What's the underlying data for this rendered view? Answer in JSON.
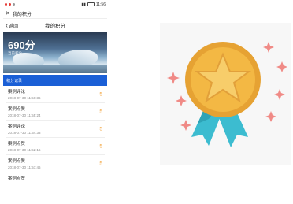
{
  "status_bar": {
    "time": "11:56"
  },
  "window": {
    "title": "我的积分",
    "more": "···"
  },
  "nav": {
    "back_label": "返回",
    "title": "我的积分"
  },
  "banner": {
    "points": "690分",
    "note": "当前积分"
  },
  "section": {
    "title": "积分记录"
  },
  "records": [
    {
      "title": "案例评论",
      "time": "2018-07-30 11:56:36",
      "score": "5"
    },
    {
      "title": "案例点赞",
      "time": "2018-07-30 11:55:24",
      "score": "5"
    },
    {
      "title": "案例评论",
      "time": "2018-07-30 11:54:33",
      "score": "5"
    },
    {
      "title": "案例点赞",
      "time": "2018-07-30 11:52:16",
      "score": "5"
    },
    {
      "title": "案例点赞",
      "time": "2018-07-30 11:51:46",
      "score": "5"
    },
    {
      "title": "案例点赞",
      "time": "",
      "score": ""
    }
  ],
  "medal": {
    "icon": "medal-star-icon",
    "colors": {
      "gold": "#f3b844",
      "gold_dark": "#e6a233",
      "ribbon": "#3cbcd0",
      "sparkle": "#f08a86"
    }
  }
}
